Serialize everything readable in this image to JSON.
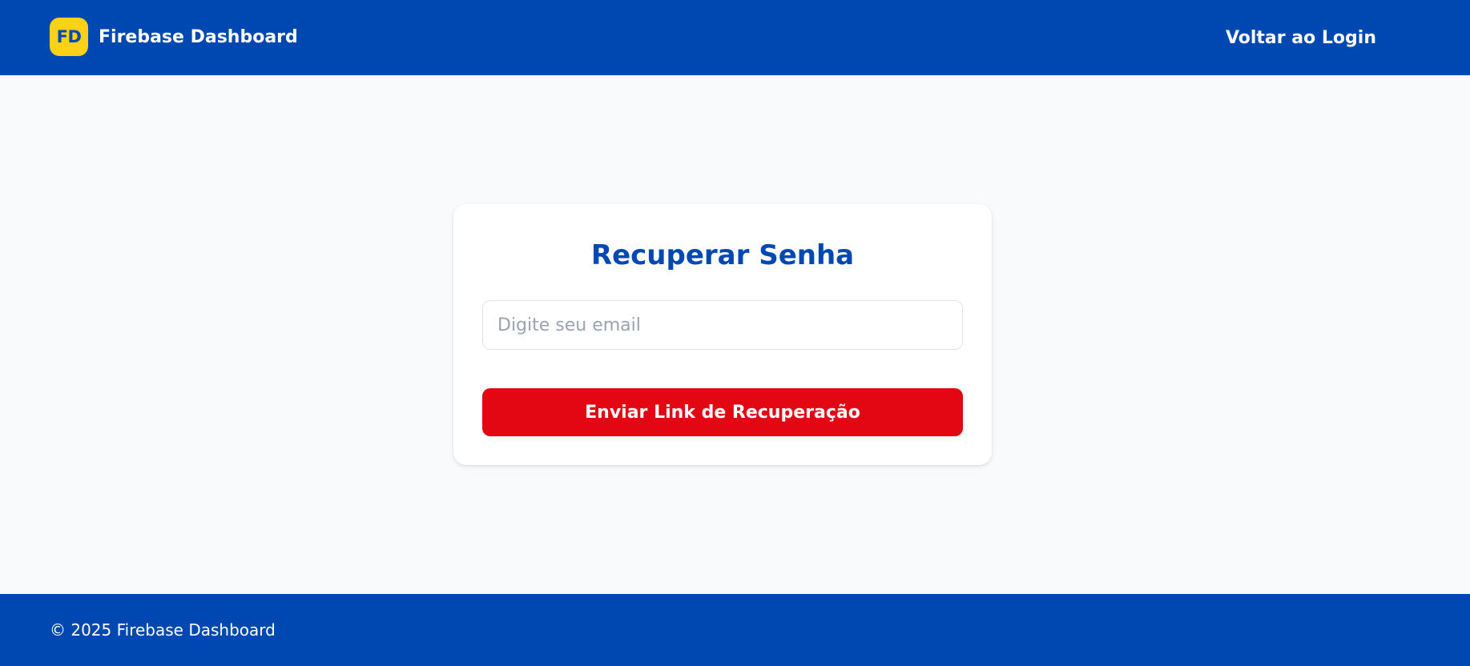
{
  "header": {
    "logo_text": "FD",
    "brand_name": "Firebase Dashboard",
    "back_link": "Voltar ao Login"
  },
  "card": {
    "title": "Recuperar Senha",
    "email_input": {
      "value": "",
      "placeholder": "Digite seu email"
    },
    "submit_label": "Enviar Link de Recuperação"
  },
  "footer": {
    "copyright": "© 2025 Firebase Dashboard"
  },
  "colors": {
    "primary": "#0048b1",
    "accent_red": "#e30613",
    "logo_yellow": "#fcd116",
    "background": "#f8fafc"
  }
}
